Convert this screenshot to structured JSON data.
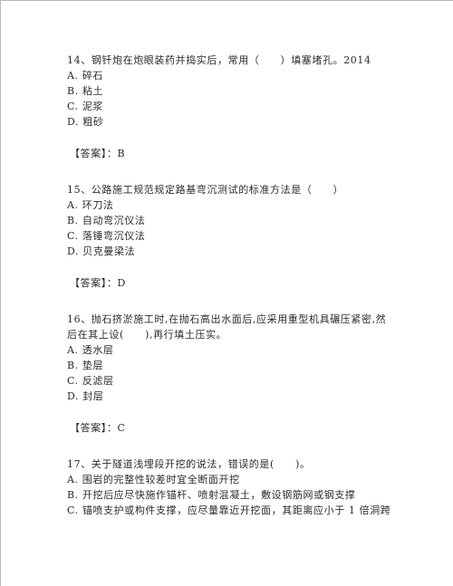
{
  "questions": [
    {
      "stem": [
        "14、钢钎炮在炮眼装药并捣实后，常用（　　）填塞堵孔。2014"
      ],
      "options": [
        "A. 碎石",
        "B. 粘土",
        "C. 泥浆",
        "D. 粗砂"
      ],
      "answer": "【答案】：B"
    },
    {
      "stem": [
        "15、公路施工规范规定路基弯沉测试的标准方法是（　　）"
      ],
      "options": [
        "A. 环刀法",
        "B. 自动弯沉仪法",
        "C. 落锤弯沉仪法",
        "D. 贝克曼梁法"
      ],
      "answer": "【答案】：D"
    },
    {
      "stem": [
        "16、抛石挤淤施工时,在抛石高出水面后,应采用重型机具碾压紧密,然",
        "后在其上设(　　),再行填土压实。"
      ],
      "options": [
        "A. 透水层",
        "B. 垫层",
        "C. 反滤层",
        "D. 封层"
      ],
      "answer": "【答案】：C"
    },
    {
      "stem": [
        "17、关于隧道浅埋段开挖的说法，错误的是(　　)。"
      ],
      "options": [
        "A. 围岩的完整性较差时宜全断面开挖",
        "B. 开挖后应尽快施作锚杆、喷射混凝土，敷设钢筋网或钢支撑",
        "C. 锚喷支护或构件支撑，应尽量靠近开挖面，其距离应小于 1 倍洞跨"
      ]
    }
  ]
}
